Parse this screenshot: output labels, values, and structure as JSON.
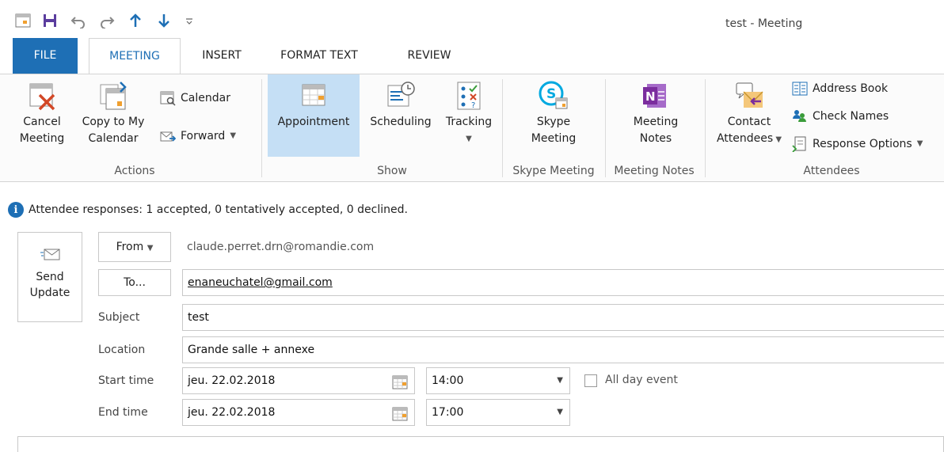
{
  "window": {
    "title": "test - Meeting"
  },
  "tabs": [
    "FILE",
    "MEETING",
    "INSERT",
    "FORMAT TEXT",
    "REVIEW"
  ],
  "ribbon": {
    "actions": {
      "cancel_line1": "Cancel",
      "cancel_line2": "Meeting",
      "copy_line1": "Copy to My",
      "copy_line2": "Calendar",
      "calendar": "Calendar",
      "forward": "Forward",
      "group": "Actions"
    },
    "show": {
      "appointment": "Appointment",
      "scheduling": "Scheduling",
      "tracking": "Tracking",
      "group": "Show"
    },
    "skype": {
      "line1": "Skype",
      "line2": "Meeting",
      "group": "Skype Meeting"
    },
    "notes": {
      "line1": "Meeting",
      "line2": "Notes",
      "group": "Meeting Notes"
    },
    "attendees": {
      "contact_line1": "Contact",
      "contact_line2": "Attendees",
      "address_book": "Address Book",
      "check_names": "Check Names",
      "response_options": "Response Options",
      "group": "Attendees"
    }
  },
  "info_bar": {
    "text": "Attendee responses: 1 accepted, 0 tentatively accepted, 0 declined."
  },
  "form": {
    "send_line1": "Send",
    "send_line2": "Update",
    "from_label": "From",
    "from_value": "claude.perret.drn@romandie.com",
    "to_label": "To...",
    "to_value": "enaneuchatel@gmail.com",
    "subject_label": "Subject",
    "subject_value": "test",
    "location_label": "Location",
    "location_value": "Grande salle + annexe",
    "start_label": "Start time",
    "start_date": "jeu. 22.02.2018",
    "start_time": "14:00",
    "all_day_label": "All day event",
    "end_label": "End time",
    "end_date": "jeu. 22.02.2018",
    "end_time": "17:00"
  },
  "colors": {
    "accent": "#1e6fb5",
    "file_tab": "#1e6fb5",
    "selected_button": "#c5dff5"
  },
  "icons": [
    "calendar-icon",
    "save-icon",
    "undo-icon",
    "redo-icon",
    "up-arrow-icon",
    "down-arrow-icon",
    "customize-icon",
    "info-icon"
  ]
}
